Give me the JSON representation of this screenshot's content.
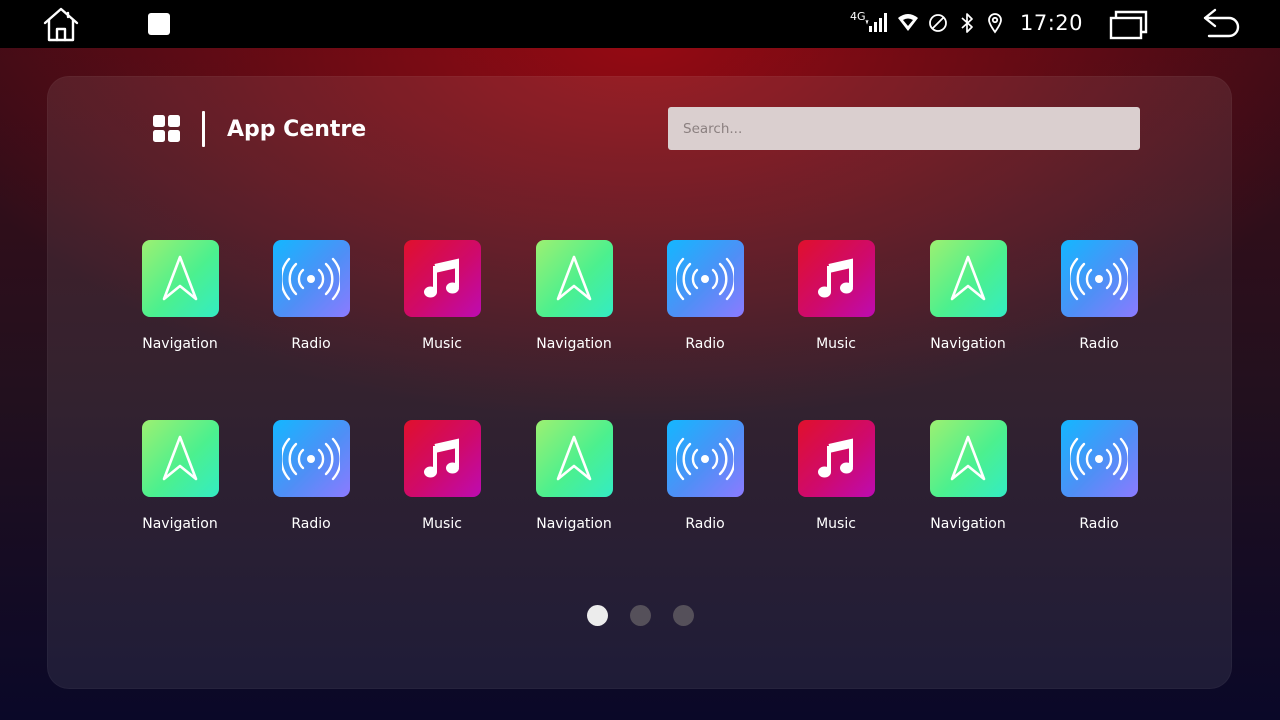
{
  "status_bar": {
    "network": "4G",
    "time": "17:20"
  },
  "header": {
    "title": "App Centre",
    "search_placeholder": "Search..."
  },
  "apps": [
    {
      "label": "Navigation",
      "icon": "navigation-arrow-icon"
    },
    {
      "label": "Radio",
      "icon": "radio-broadcast-icon"
    },
    {
      "label": "Music",
      "icon": "music-note-icon"
    },
    {
      "label": "Navigation",
      "icon": "navigation-arrow-icon"
    },
    {
      "label": "Radio",
      "icon": "radio-broadcast-icon"
    },
    {
      "label": "Music",
      "icon": "music-note-icon"
    },
    {
      "label": "Navigation",
      "icon": "navigation-arrow-icon"
    },
    {
      "label": "Radio",
      "icon": "radio-broadcast-icon"
    },
    {
      "label": "Navigation",
      "icon": "navigation-arrow-icon"
    },
    {
      "label": "Radio",
      "icon": "radio-broadcast-icon"
    },
    {
      "label": "Music",
      "icon": "music-note-icon"
    },
    {
      "label": "Navigation",
      "icon": "navigation-arrow-icon"
    },
    {
      "label": "Radio",
      "icon": "radio-broadcast-icon"
    },
    {
      "label": "Music",
      "icon": "music-note-icon"
    },
    {
      "label": "Navigation",
      "icon": "navigation-arrow-icon"
    },
    {
      "label": "Radio",
      "icon": "radio-broadcast-icon"
    }
  ],
  "pagination": {
    "current_page": 1,
    "total_pages": 3
  },
  "colors": {
    "navigation_gradient": [
      "#9cf072",
      "#33ecc3"
    ],
    "radio_gradient": [
      "#13b7ff",
      "#8c7aff"
    ],
    "music_gradient": [
      "#e0102c",
      "#bd0bb2"
    ],
    "accent_glow": "#a50a12"
  }
}
